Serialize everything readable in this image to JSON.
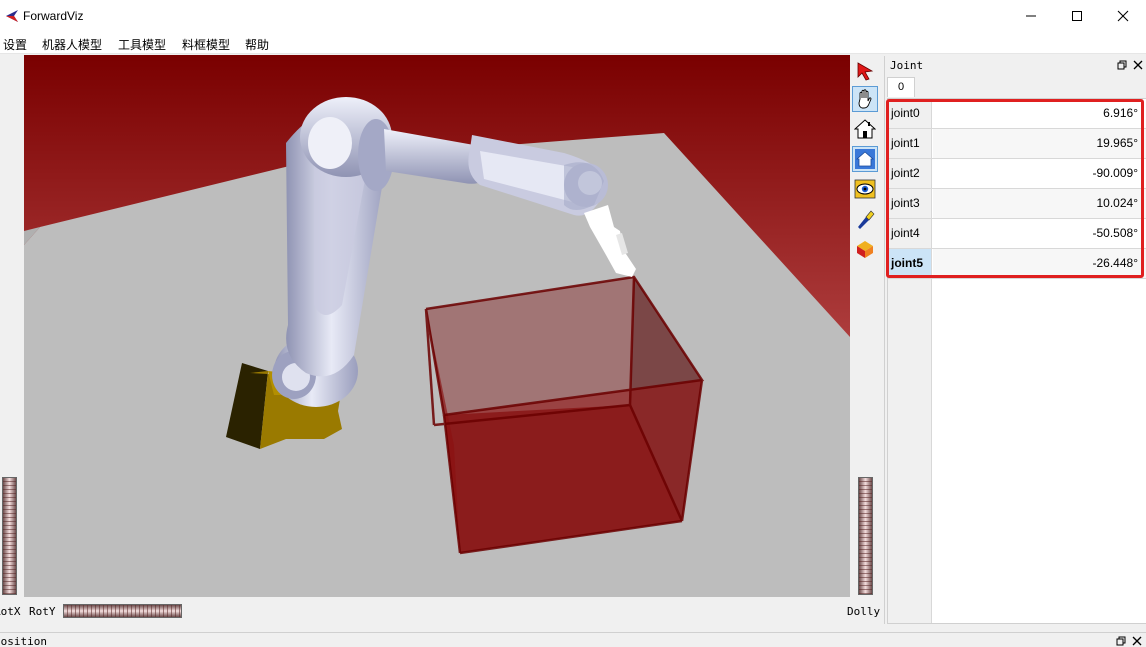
{
  "window": {
    "title": "ForwardViz"
  },
  "menu": {
    "items": [
      "设置",
      "机器人模型",
      "工具模型",
      "料框模型",
      "帮助"
    ]
  },
  "viewer": {
    "wheels": {
      "rotx_label": "RotX",
      "roty_label": "RotY",
      "dolly_label": "Dolly"
    }
  },
  "toolbar": {
    "tools": [
      {
        "icon": "pointer-arrow-icon",
        "active": false
      },
      {
        "icon": "hand-icon",
        "active": true
      },
      {
        "icon": "home-icon",
        "active": false
      },
      {
        "icon": "set-home-icon",
        "active": false
      },
      {
        "icon": "view-all-eye-icon",
        "active": false
      },
      {
        "icon": "seek-flashlight-icon",
        "active": false
      },
      {
        "icon": "projection-cube-icon",
        "active": false
      }
    ]
  },
  "joint_panel": {
    "title": "Joint",
    "tab_label": "0",
    "rows": [
      {
        "name": "joint0",
        "value": "6.916°"
      },
      {
        "name": "joint1",
        "value": "19.965°"
      },
      {
        "name": "joint2",
        "value": "-90.009°"
      },
      {
        "name": "joint3",
        "value": "10.024°"
      },
      {
        "name": "joint4",
        "value": "-50.508°"
      },
      {
        "name": "joint5",
        "value": "-26.448°"
      }
    ],
    "selected_row": 5
  },
  "bottom_dock": {
    "title": "position"
  },
  "colors": {
    "accent_selection": "#cce4f7",
    "highlight_box": "#e02020",
    "floor": "#bdbdbd",
    "background_top": "#7a0000",
    "background_bottom": "#d88a8a",
    "box": "#8b0000"
  }
}
